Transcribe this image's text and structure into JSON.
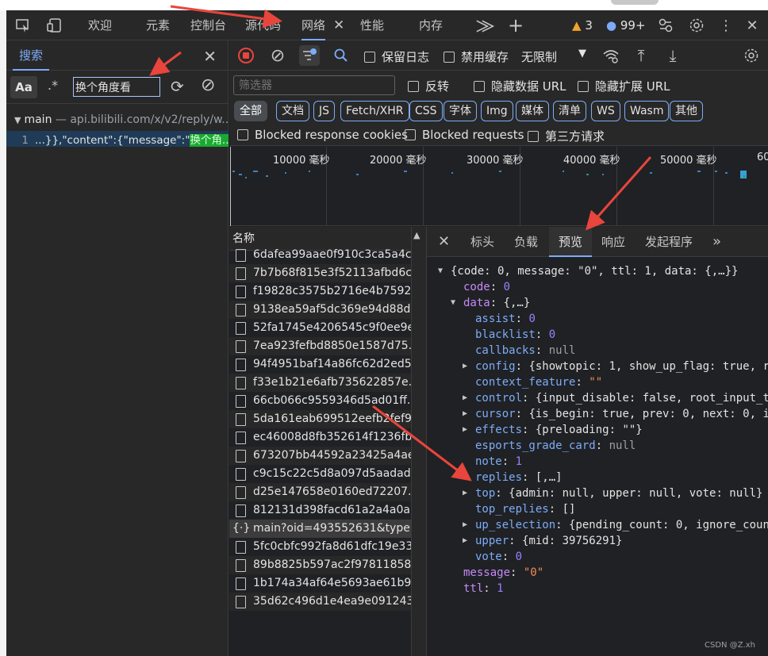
{
  "toolbar": {
    "tabs": [
      "欢迎",
      "元素",
      "控制台",
      "源代码",
      "网络",
      "性能",
      "内存"
    ],
    "warnings": "3",
    "messages": "99+"
  },
  "search": {
    "tab_label": "搜索",
    "aa": "Aa",
    "regex": ".*",
    "value": "换个角度看",
    "result_file": "main",
    "result_host": " — api.bilibili.com/x/v2/reply/w...",
    "line_no": "1",
    "line_text": "...}},\"content\":{\"message\":\"",
    "line_match": "换个角..."
  },
  "network": {
    "preserve_log": "保留日志",
    "disable_cache": "禁用缓存",
    "throttle": "无限制",
    "filter_placeholder": "筛选器",
    "invert": "反转",
    "hide_data_urls": "隐藏数据 URL",
    "hide_ext_urls": "隐藏扩展 URL",
    "types": [
      "全部",
      "文档",
      "JS",
      "Fetch/XHR",
      "CSS",
      "字体",
      "Img",
      "媒体",
      "清单",
      "WS",
      "Wasm",
      "其他"
    ],
    "blocked_cookies": "Blocked response cookies",
    "blocked_requests": "Blocked requests",
    "third_party": "第三方请求",
    "timeline_ticks": [
      "10000 毫秒",
      "20000 毫秒",
      "30000 毫秒",
      "40000 毫秒",
      "50000 毫秒",
      "60"
    ]
  },
  "requests": {
    "header": "名称",
    "rows": [
      "6dafea99aae0f910c3ca5a4c...",
      "7b7b68f815e3f52113afbd6c...",
      "f19828c3575b2716e4b7592...",
      "9138ea59af5dc369e94d88d...",
      "52fa1745e4206545c9f0ee9e...",
      "7ea923fefbd8850e1587d75...",
      "94f4951baf14a86fc62d2ed5...",
      "f33e1b21e6afb735622857e...",
      "66cb066c9559346d5ad01ff...",
      "5da161eab699512eefb2fef9...",
      "ec46008d8fb352614f1236fb...",
      "673207bb44592a23425a4ae...",
      "c9c15c22c5d8a097d5aadad...",
      "d25e147658e0160ed72207...",
      "812131d398facd61a2a4a0a...",
      "main?oid=493552631&type...",
      "5fc0cbfc992fa8d61dfc19e33...",
      "89b8825b597ac2f97811858...",
      "1b174a34af64e5693ae61b9...",
      "35d62c496d1e4ea9e091243..."
    ]
  },
  "preview": {
    "tabs": [
      "标头",
      "负载",
      "预览",
      "响应",
      "发起程序"
    ],
    "lines": [
      {
        "indent": 0,
        "arrow": "▼",
        "key": "",
        "val": "{code: 0, message: \"0\", ttl: 1, data: {,…}}",
        "vt": "plain"
      },
      {
        "indent": 1,
        "arrow": "",
        "key": "code",
        "val": "0",
        "vt": "num"
      },
      {
        "indent": 1,
        "arrow": "▼",
        "key": "data",
        "val": "{,…}",
        "vt": "plain"
      },
      {
        "indent": 2,
        "arrow": "",
        "key": "assist",
        "val": "0",
        "vt": "num"
      },
      {
        "indent": 2,
        "arrow": "",
        "key": "blacklist",
        "val": "0",
        "vt": "num"
      },
      {
        "indent": 2,
        "arrow": "",
        "key": "callbacks",
        "val": "null",
        "vt": "nul"
      },
      {
        "indent": 2,
        "arrow": "▶",
        "key": "config",
        "val": "{showtopic: 1, show_up_flag: true, re",
        "vt": "plain"
      },
      {
        "indent": 2,
        "arrow": "",
        "key": "context_feature",
        "val": "\"\"",
        "vt": "str"
      },
      {
        "indent": 2,
        "arrow": "▶",
        "key": "control",
        "val": "{input_disable: false, root_input_te",
        "vt": "plain"
      },
      {
        "indent": 2,
        "arrow": "▶",
        "key": "cursor",
        "val": "{is_begin: true, prev: 0, next: 0, is",
        "vt": "plain"
      },
      {
        "indent": 2,
        "arrow": "▶",
        "key": "effects",
        "val": "{preloading: \"\"}",
        "vt": "plain"
      },
      {
        "indent": 2,
        "arrow": "",
        "key": "esports_grade_card",
        "val": "null",
        "vt": "nul"
      },
      {
        "indent": 2,
        "arrow": "",
        "key": "note",
        "val": "1",
        "vt": "num"
      },
      {
        "indent": 2,
        "arrow": "▶",
        "key": "replies",
        "val": "[,…]",
        "vt": "plain"
      },
      {
        "indent": 2,
        "arrow": "▶",
        "key": "top",
        "val": "{admin: null, upper: null, vote: null}",
        "vt": "plain"
      },
      {
        "indent": 2,
        "arrow": "",
        "key": "top_replies",
        "val": "[]",
        "vt": "plain"
      },
      {
        "indent": 2,
        "arrow": "▶",
        "key": "up_selection",
        "val": "{pending_count: 0, ignore_count",
        "vt": "plain"
      },
      {
        "indent": 2,
        "arrow": "▶",
        "key": "upper",
        "val": "{mid: 39756291}",
        "vt": "plain"
      },
      {
        "indent": 2,
        "arrow": "",
        "key": "vote",
        "val": "0",
        "vt": "num"
      },
      {
        "indent": 1,
        "arrow": "",
        "key": "message",
        "val": "\"0\"",
        "vt": "str"
      },
      {
        "indent": 1,
        "arrow": "",
        "key": "ttl",
        "val": "1",
        "vt": "num"
      }
    ]
  },
  "watermark": "CSDN @Z.xh",
  "colors": {
    "accent": "#7cacf8",
    "annotation": "#e8453c",
    "match": "#1aaa33"
  }
}
